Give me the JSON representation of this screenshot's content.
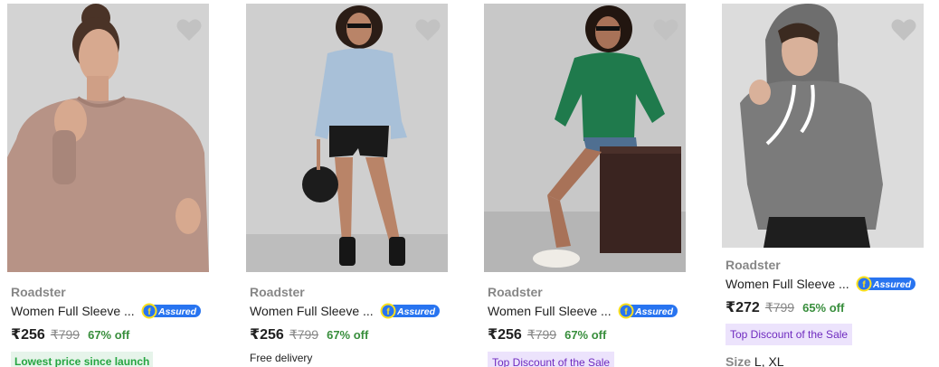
{
  "products": [
    {
      "brand": "Roadster",
      "title": "Women Full Sleeve ...",
      "assured": "Assured",
      "price": "₹256",
      "mrp": "₹799",
      "discount": "67% off",
      "tag": "Lowest price since launch",
      "tag_style": "green",
      "image_colors": {
        "bg": "#d3d3d3",
        "garment": "#b79386",
        "skin": "#d7a98f",
        "hair": "#4a3327"
      }
    },
    {
      "brand": "Roadster",
      "title": "Women Full Sleeve ...",
      "assured": "Assured",
      "price": "₹256",
      "mrp": "₹799",
      "discount": "67% off",
      "tag": "Free delivery",
      "tag_style": "plain",
      "image_colors": {
        "bg": "#cfcfcf",
        "garment": "#a8c0d8",
        "skin": "#b98468",
        "hair": "#2b1d16"
      }
    },
    {
      "brand": "Roadster",
      "title": "Women Full Sleeve ...",
      "assured": "Assured",
      "price": "₹256",
      "mrp": "₹799",
      "discount": "67% off",
      "tag": "Top Discount of the Sale",
      "tag_style": "purple",
      "image_colors": {
        "bg": "#c8c8c8",
        "garment": "#1f7a4c",
        "skin": "#a87258",
        "hair": "#221610"
      }
    },
    {
      "brand": "Roadster",
      "title": "Women Full Sleeve ...",
      "assured": "Assured",
      "price": "₹272",
      "mrp": "₹799",
      "discount": "65% off",
      "tag": "Top Discount of the Sale",
      "tag_style": "purple",
      "size_label": "Size",
      "sizes": "L, XL",
      "image_colors": {
        "bg": "#dcdcdc",
        "garment": "#7b7b7b",
        "skin": "#d9b19a",
        "hair": "#3b2a20"
      }
    }
  ],
  "colors": {
    "wishlist": "#c2c2c2",
    "assured_blue": "#2874f0",
    "assured_yellow": "#ffe11b",
    "discount_green": "#388e3c"
  }
}
